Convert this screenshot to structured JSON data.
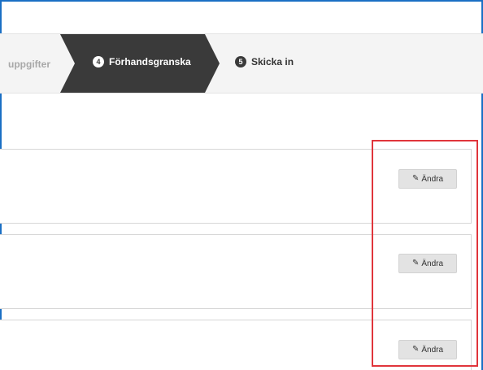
{
  "stepper": {
    "prev_label": "uppgifter",
    "active": {
      "number": "4",
      "label": "Förhandsgranska"
    },
    "next": {
      "number": "5",
      "label": "Skicka in"
    }
  },
  "edit_buttons": [
    {
      "label": "Ändra"
    },
    {
      "label": "Ändra"
    },
    {
      "label": "Ändra"
    }
  ],
  "colors": {
    "active_step": "#3a3a3a",
    "highlight": "#e0353b",
    "frame": "#1a6fc4"
  }
}
